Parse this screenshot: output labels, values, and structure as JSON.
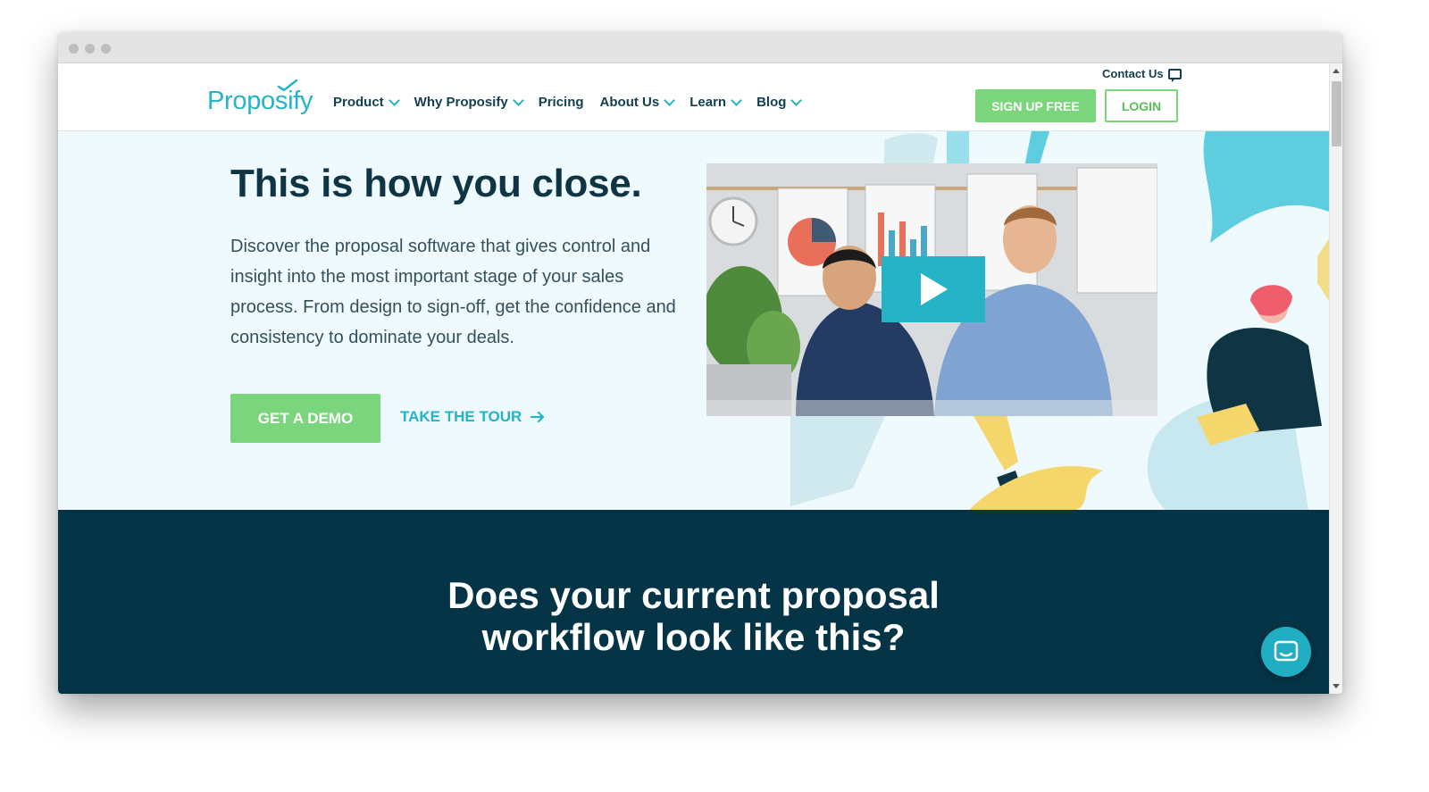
{
  "header": {
    "logo_text": "Proposify",
    "contact_label": "Contact Us",
    "nav": [
      {
        "label": "Product",
        "has_dropdown": true
      },
      {
        "label": "Why Proposify",
        "has_dropdown": true
      },
      {
        "label": "Pricing",
        "has_dropdown": false
      },
      {
        "label": "About Us",
        "has_dropdown": true
      },
      {
        "label": "Learn",
        "has_dropdown": true
      },
      {
        "label": "Blog",
        "has_dropdown": true
      }
    ],
    "signup_label": "SIGN UP FREE",
    "login_label": "LOGIN"
  },
  "hero": {
    "title": "This is how you close.",
    "description": "Discover the proposal software that gives control and insight into the most important stage of your sales process. From design to sign-off, get the confidence and consistency to dominate your deals.",
    "demo_label": "GET A DEMO",
    "tour_label": "TAKE THE TOUR"
  },
  "section2": {
    "title_line1": "Does your current proposal",
    "title_line2": "workflow look like this?"
  },
  "icons": {
    "play": "play-icon",
    "chat": "chat-icon",
    "contact": "chat-bubble-icon",
    "arrow": "arrow-right-icon"
  },
  "colors": {
    "brand": "#25b3c7",
    "green": "#7bd57c",
    "navy": "#043446",
    "hero_bg": "#eefafd"
  }
}
